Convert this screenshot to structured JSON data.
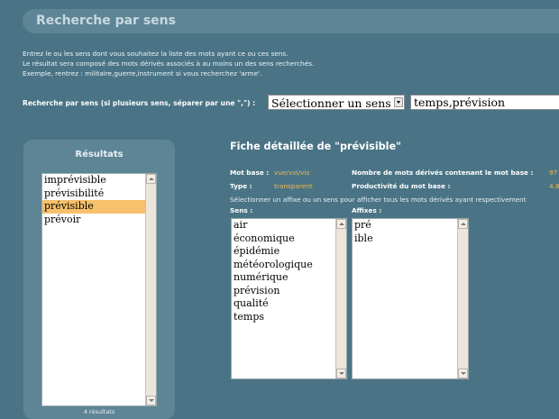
{
  "header": {
    "title": "Recherche par sens"
  },
  "intro": {
    "line1": "Entrez le ou les sens dont vous souhaitez la liste des mots ayant ce ou ces sens.",
    "line2": "Le résultat sera composé des mots dérivés associés à au moins un des sens recherchés.",
    "line3": "Exemple, rentrez : militaire,guerre,instrument si vous recherchez 'arme'."
  },
  "search": {
    "label": "Recherche par sens (si plusieurs sens, séparer par une \",\") :",
    "select_value": "Sélectionner un sens",
    "input_value": "temps,prévision"
  },
  "results": {
    "title": "Résultats",
    "items": [
      "imprévisible",
      "prévisibilité",
      "prévisible",
      "prévoir"
    ],
    "selected_item": "prévisible",
    "count_text": "4 résultats"
  },
  "fiche": {
    "title": "Fiche détaillée de \"prévisible\"",
    "mot_base_label": "Mot base :",
    "mot_base_value": "vue/voi/vis",
    "type_label": "Type :",
    "type_value": "transparent",
    "nombre_label": "Nombre de mots dérivés contenant le mot base :",
    "nombre_value": "97",
    "productivite_label": "Productivité du mot base :",
    "productivite_value": "4.8",
    "help_text": "Sélectionner un affixe ou un sens pour afficher tous les mots dérivés ayant respectivement",
    "sens_label": "Sens :",
    "sens_items": [
      "air",
      "économique",
      "épidémie",
      "météorologique",
      "numérique",
      "prévision",
      "qualité",
      "temps"
    ],
    "affixes_label": "Affixes :",
    "affixes_items": [
      "pré",
      "ible"
    ]
  },
  "colors": {
    "background": "#4a7486",
    "panel": "#5e8596",
    "value_accent": "#efb94c",
    "selection": "#f7c06b"
  }
}
